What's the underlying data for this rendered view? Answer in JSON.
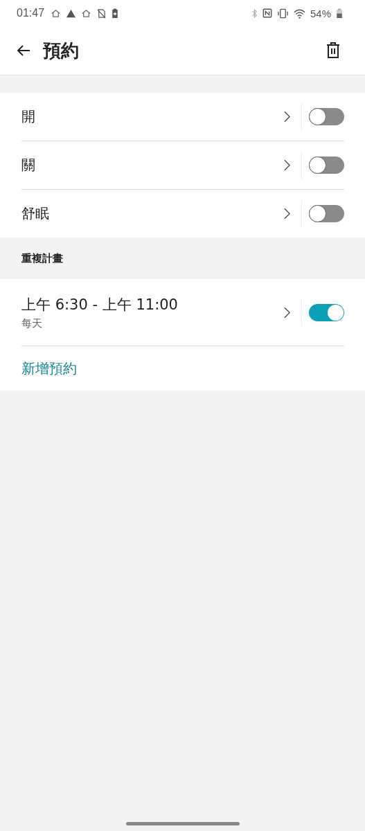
{
  "status_bar": {
    "time": "01:47",
    "battery": "54%"
  },
  "app_bar": {
    "title": "預約"
  },
  "modes": [
    {
      "label": "開",
      "on": false
    },
    {
      "label": "關",
      "on": false
    },
    {
      "label": "舒眠",
      "on": false
    }
  ],
  "section_header": "重複計畫",
  "schedules": [
    {
      "time": "上午 6:30 - 上午 11:00",
      "repeat": "每天",
      "on": true
    }
  ],
  "add_link": "新增預約"
}
